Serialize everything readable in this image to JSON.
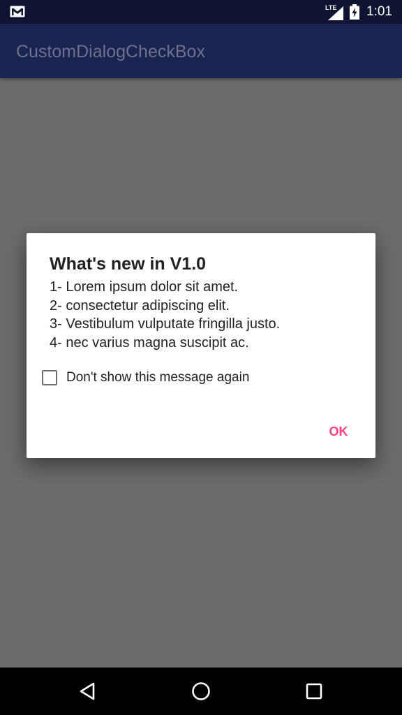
{
  "status_bar": {
    "network_label": "LTE",
    "time": "1:01",
    "icons": [
      "mail-icon",
      "lte-signal-icon",
      "battery-charging-icon"
    ]
  },
  "app_bar": {
    "title": "CustomDialogCheckBox"
  },
  "dialog": {
    "title": "What's new in V1.0",
    "lines": [
      "1- Lorem ipsum dolor sit amet.",
      "2- consectetur adipiscing elit.",
      "3- Vestibulum vulputate fringilla justo.",
      "4- nec varius magna suscipit ac."
    ],
    "checkbox": {
      "label": "Don't show this message again",
      "checked": false
    },
    "ok_label": "OK"
  },
  "nav_bar": {
    "icons": [
      "back-icon",
      "home-icon",
      "recents-icon"
    ]
  },
  "colors": {
    "status_bar": "#0e1431",
    "app_bar_dimmed": "#1b2351",
    "scrim_background": "#6b6b6b",
    "accent": "#ff4081",
    "dialog_background": "#ffffff"
  }
}
